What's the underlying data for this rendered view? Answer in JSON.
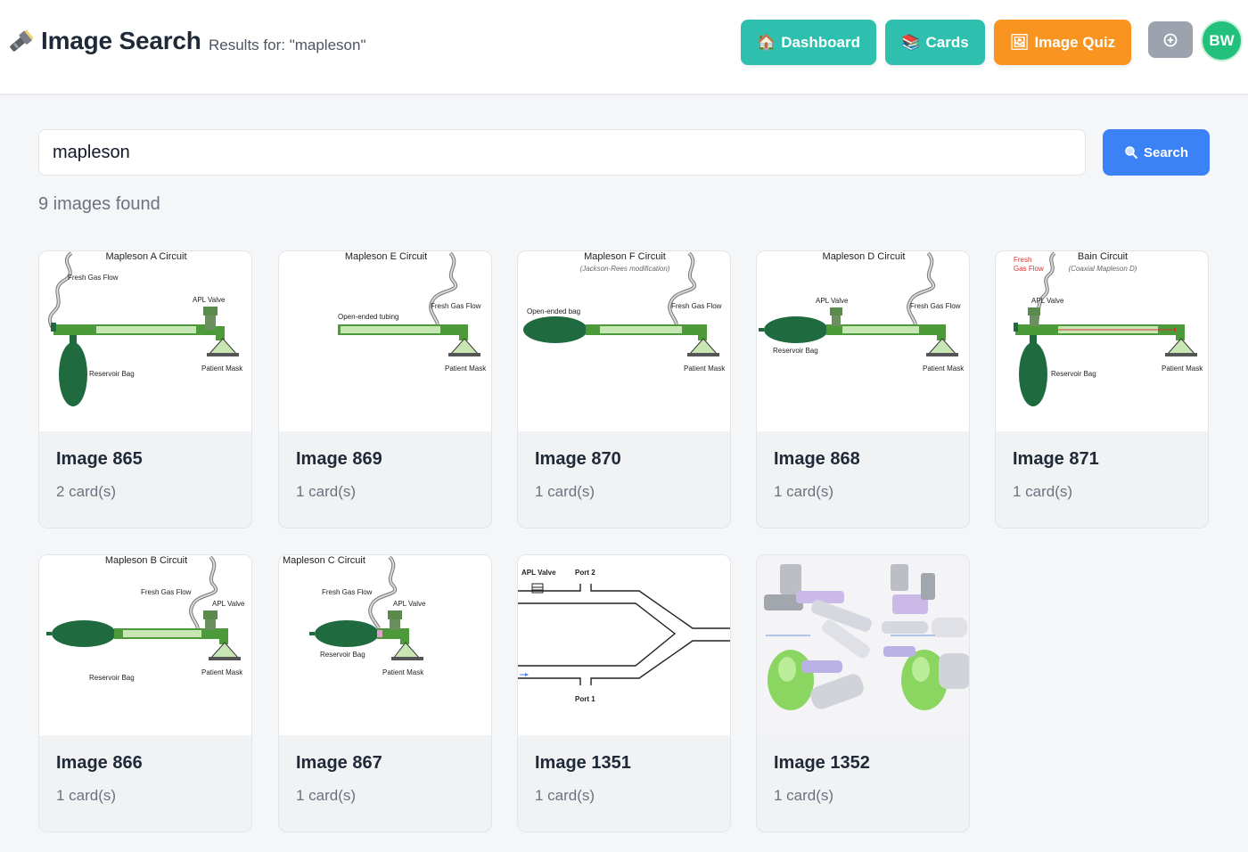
{
  "header": {
    "title": "Image Search",
    "subtitle": "Results for: \"mapleson\"",
    "nav": {
      "dashboard": "Dashboard",
      "cards": "Cards",
      "quiz": "Image Quiz"
    },
    "avatar_initials": "BW"
  },
  "search": {
    "value": "mapleson",
    "button_label": "Search"
  },
  "results": {
    "count_text": "9 images found",
    "items": [
      {
        "title": "Image 865",
        "count": "2 card(s)"
      },
      {
        "title": "Image 869",
        "count": "1 card(s)"
      },
      {
        "title": "Image 870",
        "count": "1 card(s)"
      },
      {
        "title": "Image 868",
        "count": "1 card(s)"
      },
      {
        "title": "Image 871",
        "count": "1 card(s)"
      },
      {
        "title": "Image 866",
        "count": "1 card(s)"
      },
      {
        "title": "Image 867",
        "count": "1 card(s)"
      },
      {
        "title": "Image 1351",
        "count": "1 card(s)"
      },
      {
        "title": "Image 1352",
        "count": "1 card(s)"
      }
    ]
  },
  "diagrams": {
    "a": {
      "title": "Mapleson A Circuit",
      "fgf": "Fresh Gas Flow",
      "apl": "APL Valve",
      "bag": "Reservoir Bag",
      "mask": "Patient Mask"
    },
    "e": {
      "title": "Mapleson E Circuit",
      "tube": "Open-ended tubing",
      "fgf": "Fresh Gas Flow",
      "mask": "Patient Mask"
    },
    "f": {
      "title": "Mapleson F Circuit",
      "sub": "(Jackson-Rees modification)",
      "bag": "Open-ended bag",
      "fgf": "Fresh Gas Flow",
      "mask": "Patient Mask"
    },
    "d": {
      "title": "Mapleson D Circuit",
      "apl": "APL Valve",
      "fgf": "Fresh Gas Flow",
      "bag": "Reservoir Bag",
      "mask": "Patient Mask"
    },
    "bain": {
      "title": "Bain Circuit",
      "sub": "(Coaxial Mapleson D)",
      "fgf1": "Fresh",
      "fgf2": "Gas Flow",
      "apl": "APL Valve",
      "bag": "Reservoir Bag",
      "mask": "Patient Mask"
    },
    "b": {
      "title": "Mapleson B Circuit",
      "fgf": "Fresh Gas Flow",
      "apl": "APL Valve",
      "bag": "Reservoir Bag",
      "mask": "Patient Mask"
    },
    "c": {
      "title": "Mapleson C Circuit",
      "fgf": "Fresh Gas Flow",
      "apl": "APL Valve",
      "bag": "Reservoir Bag",
      "mask": "Patient Mask"
    },
    "ports": {
      "apl": "APL Valve",
      "port2": "Port 2",
      "port1": "Port 1"
    }
  },
  "colors": {
    "teal": "#2fbfae",
    "orange": "#f99421",
    "blue": "#3b82f6",
    "green_avatar": "#22c07a",
    "circuit_green": "#1f6b3f",
    "tube_green": "#c8e6b4"
  }
}
